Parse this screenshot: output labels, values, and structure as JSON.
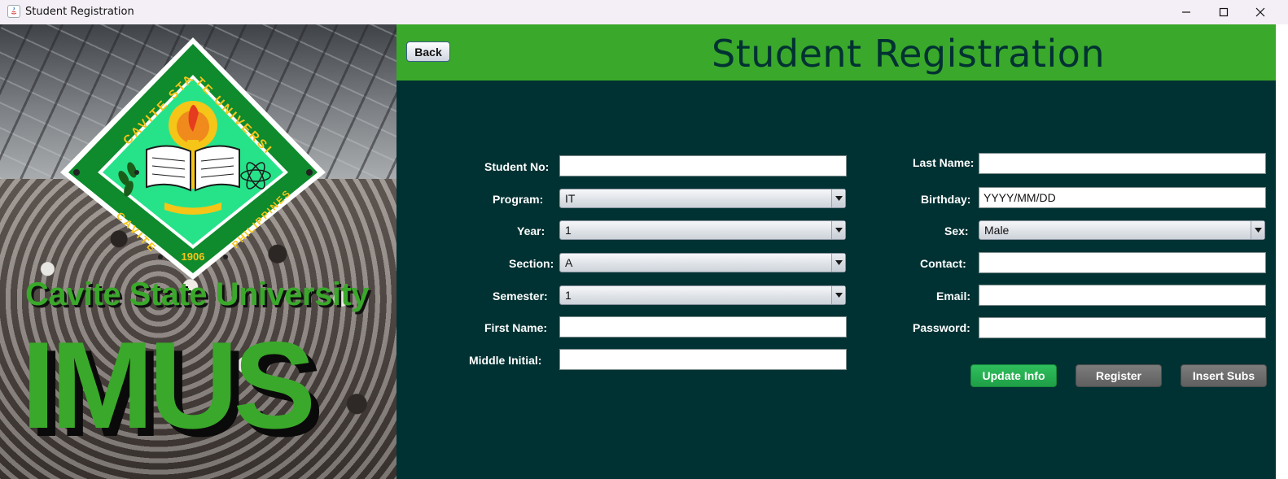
{
  "window": {
    "title": "Student Registration",
    "controls": [
      "minimize-icon",
      "maximize-icon",
      "close-icon"
    ]
  },
  "branding": {
    "university_name": "Cavite State University",
    "campus": "IMUS",
    "logo": {
      "top_text": "CAVITE STATE UNIVERSITY",
      "left_text": "CAVITE",
      "right_text": "PHILIPPINES",
      "year": "1906"
    }
  },
  "header": {
    "back_label": "Back",
    "title": "Student Registration"
  },
  "form": {
    "left": {
      "student_no": {
        "label": "Student No:",
        "value": ""
      },
      "program": {
        "label": "Program:",
        "value": "IT"
      },
      "year": {
        "label": "Year:",
        "value": "1"
      },
      "section": {
        "label": "Section:",
        "value": "A"
      },
      "semester": {
        "label": "Semester:",
        "value": "1"
      },
      "first_name": {
        "label": "First Name:",
        "value": ""
      },
      "middle_initial": {
        "label": "Middle Initial:",
        "value": ""
      }
    },
    "right": {
      "last_name": {
        "label": "Last Name:",
        "value": ""
      },
      "birthday": {
        "label": "Birthday:",
        "value": "YYYY/MM/DD"
      },
      "sex": {
        "label": "Sex:",
        "value": "Male"
      },
      "contact": {
        "label": "Contact:",
        "value": ""
      },
      "email": {
        "label": "Email:",
        "value": ""
      },
      "password": {
        "label": "Password:",
        "value": ""
      }
    }
  },
  "actions": {
    "update_label": "Update Info",
    "register_label": "Register",
    "insert_subs_label": "Insert Subs"
  },
  "colors": {
    "header_green": "#3aa82a",
    "panel_dark": "#013233",
    "update_button": "#22ad4e",
    "gray_button": "#6e6e6e"
  }
}
